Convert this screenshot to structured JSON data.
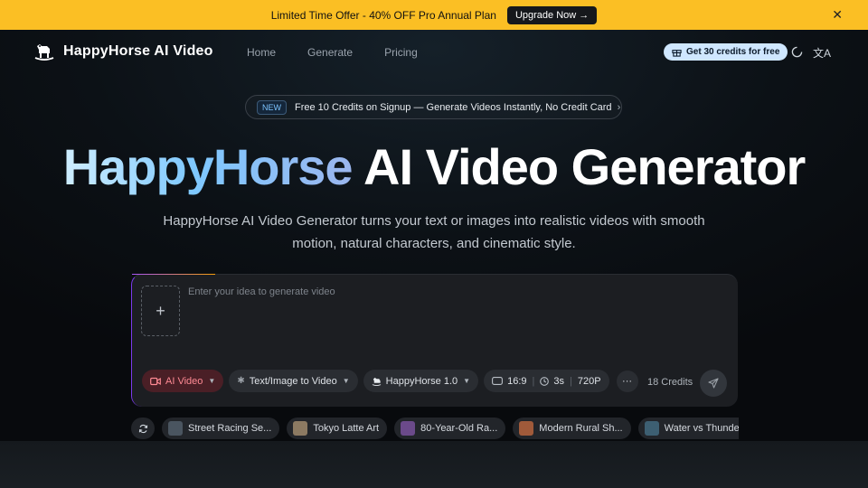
{
  "promo": {
    "text": "Limited Time Offer - 40% OFF Pro Annual Plan",
    "cta": "Upgrade Now →",
    "close": "✕"
  },
  "nav": {
    "brand": "HappyHorse AI Video",
    "links": [
      "Home",
      "Generate",
      "Pricing"
    ],
    "credits_pill": "Get 30 credits for free",
    "lang_icon": "文A"
  },
  "announce": {
    "badge": "NEW",
    "text": "Free 10 Credits on Signup — Generate Videos Instantly, No Credit Card",
    "chevron": "›"
  },
  "hero": {
    "title_highlight": "HappyHorse",
    "title_rest": " AI Video Generator",
    "subtitle": "HappyHorse AI Video Generator turns your text or images into realistic videos with smooth motion, natural characters, and cinematic style."
  },
  "composer": {
    "upload_plus": "+",
    "placeholder": "Enter your idea to generate video",
    "mode": "AI Video",
    "type": "Text/Image to Video",
    "model": "HappyHorse 1.0",
    "ratio": "16:9",
    "duration": "3s",
    "resolution": "720P",
    "more": "···",
    "credits": "18 Credits"
  },
  "samples": [
    {
      "label": "Street Racing Se...",
      "color": "#4a5560"
    },
    {
      "label": "Tokyo Latte Art",
      "color": "#8c7a62"
    },
    {
      "label": "80-Year-Old Ra...",
      "color": "#6b4a8a"
    },
    {
      "label": "Modern Rural Sh...",
      "color": "#a05a3a"
    },
    {
      "label": "Water vs Thunde...",
      "color": "#3d5f72"
    }
  ],
  "colors": {
    "promo_bg": "#fbbf24",
    "accent": "#7ec8ff",
    "mode_chip": "#ff8a94"
  }
}
